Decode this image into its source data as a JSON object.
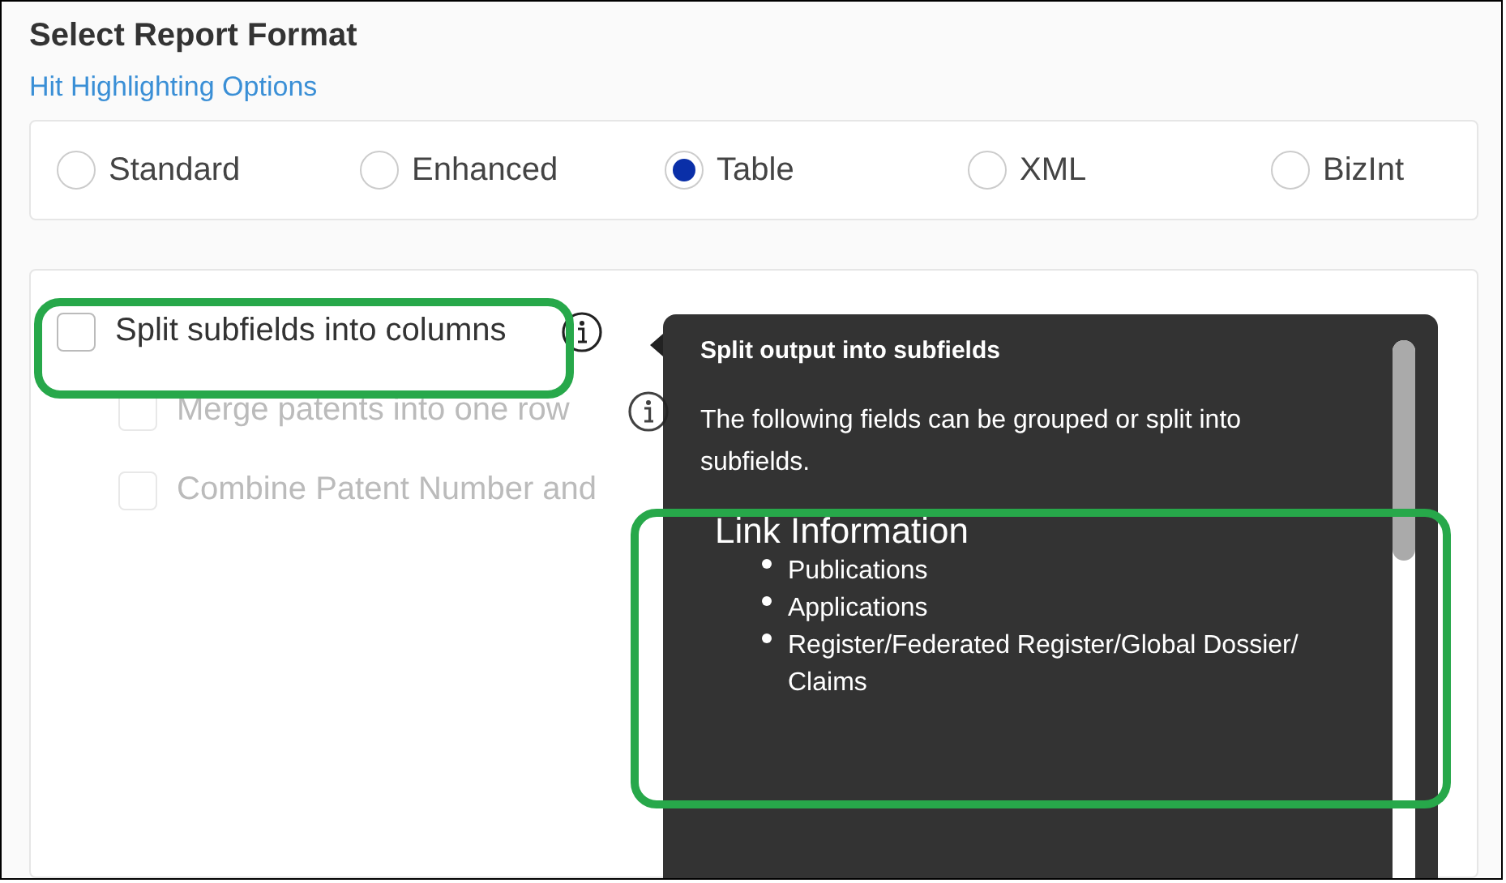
{
  "heading": "Select Report Format",
  "link": "Hit Highlighting Options",
  "formats": [
    {
      "label": "Standard",
      "selected": false
    },
    {
      "label": "Enhanced",
      "selected": false
    },
    {
      "label": "Table",
      "selected": true
    },
    {
      "label": "XML",
      "selected": false
    },
    {
      "label": "BizInt",
      "selected": false
    }
  ],
  "options": [
    {
      "label": "Split subfields into columns",
      "checked": false,
      "disabled": false,
      "info": true
    },
    {
      "label": "Merge patents into one row",
      "checked": false,
      "disabled": true,
      "info": true
    },
    {
      "label": "Combine Patent Number and",
      "checked": false,
      "disabled": true,
      "info": false
    }
  ],
  "tooltip": {
    "title": "Split output into subfields",
    "text": "The following fields can be grouped or split into subfields.",
    "group": "Link Information",
    "items": [
      "Publications",
      "Applications",
      "Register/Federated Register/Global Dossier/ Claims"
    ]
  }
}
